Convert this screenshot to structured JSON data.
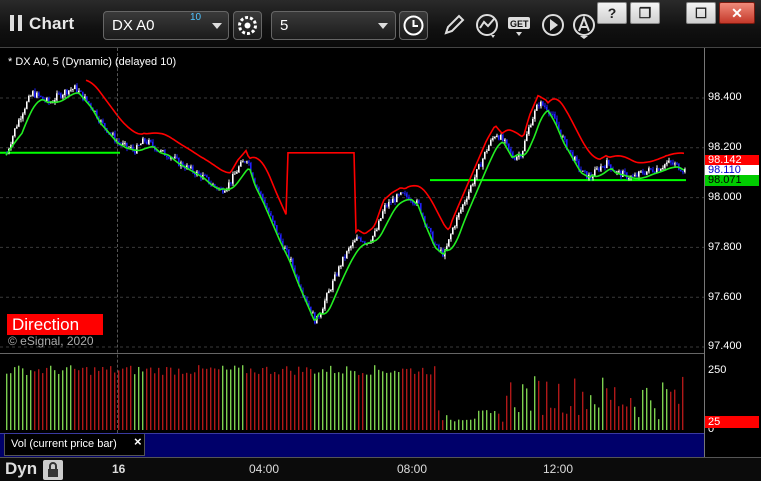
{
  "window": {
    "title": "Chart",
    "symbol": "DX A0",
    "symbol_superscript": "10",
    "interval": "5",
    "help_label": "?",
    "restore_label": "❐",
    "maximize_label": "☐",
    "close_label": "✕",
    "icons": [
      "gear-icon",
      "clock-icon",
      "pencil-icon",
      "study-icon",
      "get-icon",
      "play-icon",
      "alert-icon"
    ]
  },
  "chart": {
    "study_label": "* DX A0, 5 (Dynamic) (delayed 10)",
    "direction_label": "Direction",
    "copyright": "© eSignal, 2020",
    "price_ticks": [
      "98.400",
      "98.200",
      "98.000",
      "97.800",
      "97.600",
      "97.400"
    ],
    "badges": [
      {
        "text": "98.142",
        "bg": "#ff0000",
        "color": "#ffffff"
      },
      {
        "text": "98.110",
        "bg": "#ffffff",
        "color": "#0000cc"
      },
      {
        "text": "98.071",
        "bg": "#00cc00",
        "color": "#000000"
      }
    ],
    "colors": {
      "up_bar": "#ffffff",
      "down_bar": "#2020ff",
      "red_line": "#ff0000",
      "green_line": "#22ee22",
      "flat_line": "#00ff00"
    }
  },
  "volume": {
    "ticks": [
      "250",
      "0"
    ],
    "badge": "25",
    "tab_label": "Vol (current price bar)",
    "tab_close": "×"
  },
  "time_axis": {
    "dyn_label": "Dyn",
    "date_tick": "16",
    "ticks": [
      "04:00",
      "08:00",
      "12:00"
    ]
  },
  "chart_data": {
    "type": "candlestick",
    "y_range": [
      97.4,
      98.5
    ],
    "x_labels": [
      "16",
      "04:00",
      "08:00",
      "12:00"
    ],
    "close_series_approx": [
      98.18,
      98.28,
      98.36,
      98.42,
      98.4,
      98.38,
      98.41,
      98.43,
      98.44,
      98.4,
      98.36,
      98.3,
      98.26,
      98.22,
      98.2,
      98.19,
      98.23,
      98.21,
      98.18,
      98.17,
      98.14,
      98.12,
      98.1,
      98.08,
      98.05,
      98.03,
      98.06,
      98.12,
      98.16,
      98.05,
      97.98,
      97.9,
      97.82,
      97.75,
      97.66,
      97.58,
      97.5,
      97.58,
      97.66,
      97.74,
      97.8,
      97.84,
      97.82,
      97.86,
      97.96,
      97.99,
      98.01,
      98.0,
      97.97,
      97.88,
      97.8,
      97.77,
      97.88,
      97.96,
      98.04,
      98.12,
      98.2,
      98.26,
      98.22,
      98.16,
      98.18,
      98.3,
      98.38,
      98.36,
      98.3,
      98.22,
      98.16,
      98.1,
      98.08,
      98.12,
      98.14,
      98.1,
      98.09,
      98.08,
      98.1,
      98.11,
      98.12,
      98.14,
      98.13,
      98.11
    ],
    "flat_level_green": 98.142,
    "red_stop_level": 98.071
  }
}
